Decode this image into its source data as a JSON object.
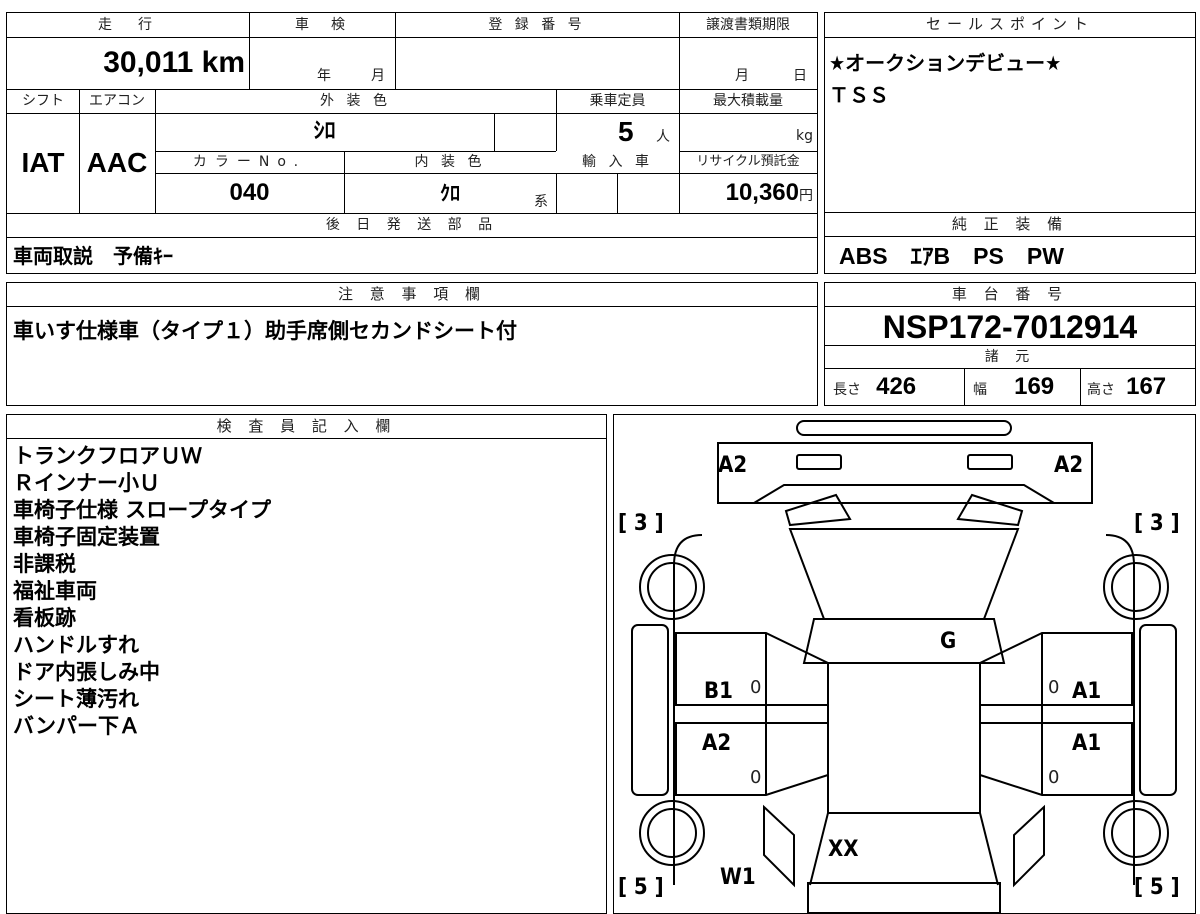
{
  "mileage": {
    "header": "走　行",
    "value": "30,011",
    "unit": "km"
  },
  "inspection": {
    "header": "車　検",
    "year_label": "年",
    "month_label": "月"
  },
  "registration": {
    "header": "登 録 番 号",
    "value": ""
  },
  "transfer_deadline": {
    "header": "譲渡書類期限",
    "month_label": "月",
    "day_label": "日"
  },
  "sales_points": {
    "header": "セールスポイント",
    "lines": [
      "★オークションデビュー★",
      "ＴＳＳ"
    ]
  },
  "shift": {
    "header": "シフト",
    "value": "IAT"
  },
  "aircon": {
    "header": "エアコン",
    "value": "AAC"
  },
  "exterior_color": {
    "header": "外 装 色",
    "value": "ｼﾛ"
  },
  "capacity": {
    "header": "乗車定員",
    "value": "5",
    "unit": "人"
  },
  "max_load": {
    "header": "最大積載量",
    "value": "",
    "unit": "kg"
  },
  "color_no": {
    "header": "カラーNo.",
    "value": "040"
  },
  "interior_color": {
    "header": "内 装 色",
    "value": "ｸﾛ",
    "suffix": "系"
  },
  "import": {
    "header": "輸 入 車",
    "value": ""
  },
  "recycle": {
    "header": "リサイクル預託金",
    "value": "10,360",
    "unit": "円"
  },
  "later_parts": {
    "header": "後 日 発 送 部 品",
    "value": "車両取説　予備ｷｰ"
  },
  "genuine_equipment": {
    "header": "純 正 装 備",
    "value": "ABS　ｴｱB　PS　PW"
  },
  "caution": {
    "header": "注 意 事 項 欄",
    "value": "車いす仕様車（タイプ１）助手席側セカンドシート付"
  },
  "chassis": {
    "header": "車 台 番 号",
    "value": "NSP172-7012914"
  },
  "specs": {
    "header": "諸 元",
    "length_label": "長さ",
    "length": "426",
    "width_label": "幅",
    "width": "169",
    "height_label": "高さ",
    "height": "167"
  },
  "inspector": {
    "header": "検 査 員 記 入 欄",
    "notes": [
      "トランクフロアＵＷ",
      "Ｒインナー小Ｕ",
      "車椅子仕様 スロープタイプ",
      "車椅子固定装置",
      "非課税",
      "福祉車両",
      "看板跡",
      "ハンドルすれ",
      "ドア内張しみ中",
      "シート薄汚れ",
      "バンパー下Ａ"
    ]
  },
  "diagram": {
    "bumper_left": "A2",
    "bumper_right": "A2",
    "front_left_bracket": "[ 3 ]",
    "front_right_bracket": "[ 3 ]",
    "rear_left_bracket": "[ 5 ]",
    "rear_right_bracket": "[ 5 ]",
    "roof": "G",
    "front_door_left": "B1",
    "front_door_right": "A1",
    "rear_door_left": "A2",
    "rear_door_right": "A1",
    "door_mark_0": "0",
    "trunk": "XX",
    "rear_left_quarter": "W1"
  }
}
